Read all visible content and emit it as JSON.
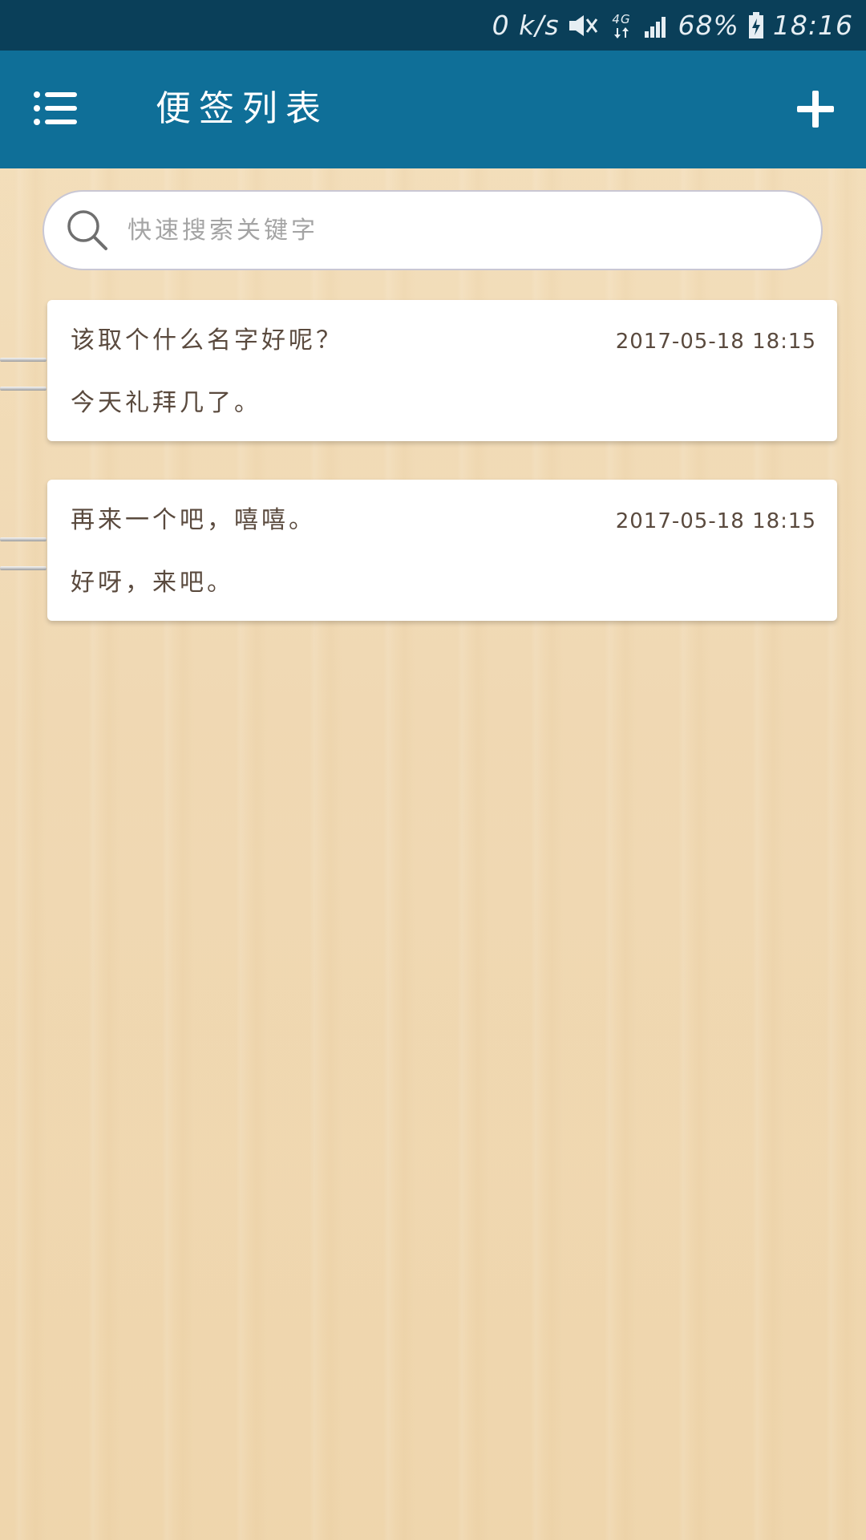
{
  "status_bar": {
    "network_speed": "0 k/s",
    "network_type": "4G",
    "battery": "68%",
    "time": "18:16",
    "icons": [
      "mute-icon",
      "network-4g-icon",
      "signal-icon",
      "battery-icon"
    ]
  },
  "app_bar": {
    "title": "便签列表",
    "menu_icon": "list-menu-icon",
    "add_icon": "plus-icon",
    "background": "#0f6f98"
  },
  "search": {
    "placeholder": "快速搜索关键字",
    "value": ""
  },
  "notes": [
    {
      "title": "该取个什么名字好呢？",
      "time": "2017-05-18 18:15",
      "content": "今天礼拜几了。"
    },
    {
      "title": "再来一个吧，嘻嘻。",
      "time": "2017-05-18 18:15",
      "content": "好呀，来吧。"
    }
  ],
  "colors": {
    "status_bar": "#0a3f59",
    "text_primary": "#5a4a3e",
    "background": "#f2dcb8"
  }
}
